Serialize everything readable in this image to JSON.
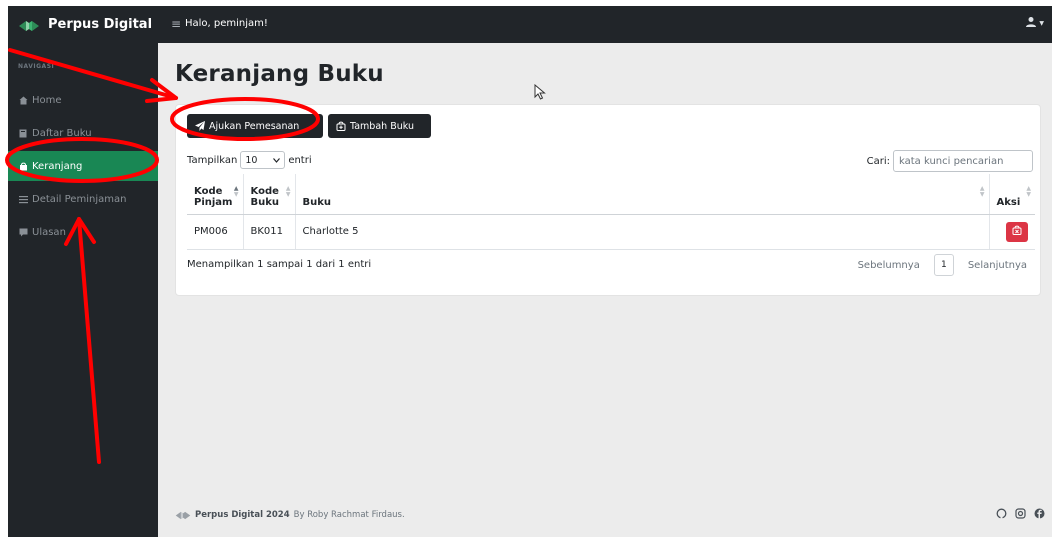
{
  "colors": {
    "topbar": "#212529",
    "sidebar": "#212529",
    "active_nav": "#198754",
    "danger": "#dc3545",
    "annotation": "#ff0000"
  },
  "header": {
    "brand": "Perpus Digital",
    "greeting": "Halo, peminjam!",
    "toggler_icon": "hamburger-icon",
    "user_icon": "user-icon"
  },
  "sidebar": {
    "heading": "NAVIGASI",
    "items": [
      {
        "label": "Home",
        "icon": "home-icon"
      },
      {
        "label": "Daftar Buku",
        "icon": "book-icon"
      },
      {
        "label": "Keranjang",
        "icon": "cart-icon",
        "active": true
      },
      {
        "label": "Detail Peminjaman",
        "icon": "list-icon"
      },
      {
        "label": "Ulasan",
        "icon": "comment-icon"
      }
    ]
  },
  "main": {
    "title": "Keranjang Buku",
    "buttons": {
      "ajukan": "Ajukan Pemesanan",
      "tambah": "Tambah Buku"
    },
    "length": {
      "prefix": "Tampilkan",
      "value": "10",
      "suffix": "entri"
    },
    "search": {
      "label": "Cari:",
      "placeholder": "kata kunci pencarian"
    },
    "table": {
      "headers": [
        {
          "line1": "Kode",
          "line2": "Pinjam"
        },
        {
          "line1": "Kode",
          "line2": "Buku"
        },
        {
          "line1": "Buku",
          "line2": ""
        },
        {
          "line1": "Aksi",
          "line2": ""
        }
      ],
      "rows": [
        {
          "kode_pinjam": "PM006",
          "kode_buku": "BK011",
          "buku": "Charlotte 5"
        }
      ]
    },
    "info": "Menampilkan 1 sampai 1 dari 1 entri",
    "pager": {
      "prev": "Sebelumnya",
      "current": "1",
      "next": "Selanjutnya"
    }
  },
  "footer": {
    "brand": "Perpus Digital 2024",
    "credit": "By Roby Rachmat Firdaus.",
    "social_icons": [
      "github-icon",
      "instagram-icon",
      "facebook-icon"
    ]
  }
}
